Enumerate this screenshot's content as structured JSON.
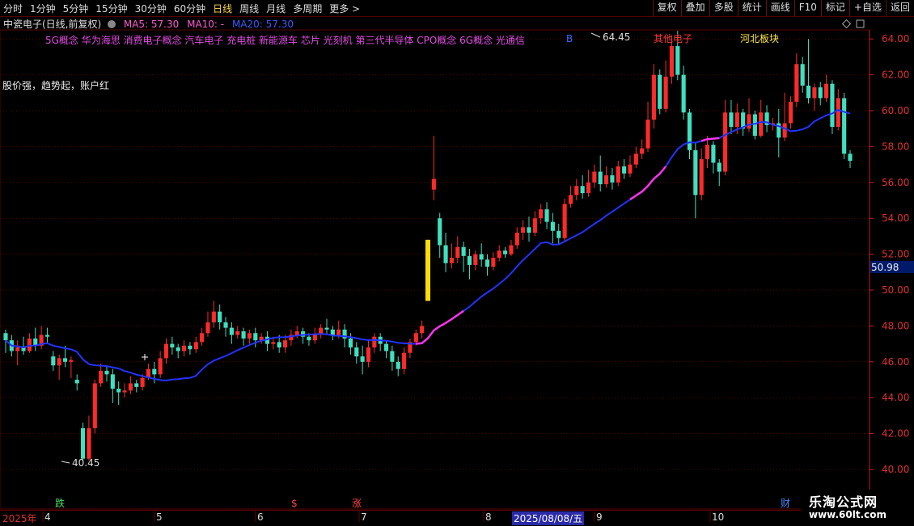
{
  "toolbar": {
    "periods": [
      "分时",
      "1分钟",
      "5分钟",
      "15分钟",
      "30分钟",
      "60分钟",
      "日线",
      "周线",
      "月线",
      "多周期",
      "更多"
    ],
    "active_period": "日线",
    "more_arrow": ">",
    "actions": [
      "复权",
      "叠加",
      "多股",
      "统计",
      "画线",
      "F10",
      "标记",
      "+自选",
      "返回"
    ]
  },
  "info": {
    "stock_title": "中瓷电子(日线,前复权)",
    "ma5": "MA5: 57.30",
    "ma10": "MA10: -",
    "ma20": "MA20: 57.30"
  },
  "concepts": "5G概念 华为海思 消费电子概念 汽车电子 充电桩 新能源车 芯片 光刻机 第三代半导体 CPO概念 6G概念 光通信",
  "slogan": "股价强，趋势起，账户红",
  "markers": {
    "b_label": "B",
    "sector_other": "其他电子",
    "sector_region": "河北板块",
    "high_label": "64.45",
    "low_label": "40.45",
    "current_price": "50.98",
    "fall_badge": "跌",
    "dollar_badge": "$",
    "rise_badge": "涨",
    "fin_badge": "财"
  },
  "dates": {
    "year": "2025年",
    "months": [
      "4",
      "5",
      "6",
      "7",
      "8",
      "9",
      "10"
    ],
    "cursor_date": "2025/08/08/五"
  },
  "watermark": {
    "line1": "乐淘公式网",
    "line2": "www.60lt.com"
  },
  "colors": {
    "up": "#ff2a2a",
    "down": "#3ee0c0",
    "grid": "#5a0000",
    "axis": "#cc2020",
    "ma_blue": "#2233ff",
    "ma_pink": "#ff33ee",
    "volume_bar": "#ffdd00"
  },
  "chart_data": {
    "type": "candlestick",
    "ylim": [
      39,
      65
    ],
    "y_ticks": [
      "40.00",
      "42.00",
      "44.00",
      "46.00",
      "48.00",
      "50.00",
      "52.00",
      "54.00",
      "56.00",
      "58.00",
      "60.00",
      "62.00",
      "64.00"
    ],
    "candles": [
      [
        47.6,
        47.2,
        47.8,
        46.5
      ],
      [
        47.2,
        46.6,
        47.5,
        46.3
      ],
      [
        46.6,
        46.8,
        47.2,
        45.8
      ],
      [
        46.8,
        46.6,
        47.4,
        46.4
      ],
      [
        46.6,
        47.3,
        47.6,
        46.5
      ],
      [
        47.3,
        46.9,
        47.9,
        46.6
      ],
      [
        46.9,
        47.5,
        48.0,
        46.7
      ],
      [
        47.5,
        47.4,
        47.9,
        47.0
      ],
      [
        46.3,
        45.8,
        46.6,
        45.5
      ],
      [
        45.8,
        46.2,
        46.4,
        45.0
      ],
      [
        46.2,
        46.0,
        46.9,
        45.7
      ],
      [
        46.0,
        46.1,
        46.3,
        45.1
      ],
      [
        45.0,
        44.8,
        45.3,
        44.4
      ],
      [
        42.3,
        40.6,
        42.6,
        40.45
      ],
      [
        40.6,
        42.3,
        43.0,
        40.5
      ],
      [
        42.3,
        44.8,
        45.0,
        42.0
      ],
      [
        44.8,
        45.5,
        45.9,
        44.6
      ],
      [
        45.5,
        45.3,
        45.8,
        44.9
      ],
      [
        45.3,
        44.5,
        45.6,
        43.7
      ],
      [
        44.5,
        44.3,
        44.9,
        43.6
      ],
      [
        44.3,
        44.4,
        44.8,
        44.0
      ],
      [
        44.4,
        44.8,
        45.2,
        44.2
      ],
      [
        44.8,
        44.6,
        45.0,
        44.3
      ],
      [
        44.6,
        45.1,
        45.3,
        44.4
      ],
      [
        45.1,
        45.6,
        45.9,
        45.0
      ],
      [
        45.6,
        45.3,
        46.0,
        44.8
      ],
      [
        45.3,
        46.2,
        46.6,
        45.1
      ],
      [
        46.2,
        47.0,
        47.3,
        45.9
      ],
      [
        47.0,
        46.8,
        47.4,
        46.4
      ],
      [
        46.8,
        46.6,
        47.0,
        46.2
      ],
      [
        46.6,
        46.9,
        47.2,
        46.3
      ],
      [
        46.9,
        46.7,
        47.1,
        46.4
      ],
      [
        46.7,
        47.1,
        47.4,
        46.5
      ],
      [
        47.1,
        47.6,
        47.9,
        46.9
      ],
      [
        47.6,
        48.2,
        48.8,
        47.4
      ],
      [
        48.2,
        48.8,
        49.4,
        47.9
      ],
      [
        48.8,
        48.2,
        49.2,
        47.8
      ],
      [
        48.2,
        47.9,
        48.5,
        47.4
      ],
      [
        47.9,
        47.5,
        48.2,
        47.0
      ],
      [
        47.5,
        47.7,
        48.0,
        47.3
      ],
      [
        47.7,
        47.3,
        47.9,
        46.9
      ],
      [
        47.3,
        47.6,
        47.8,
        47.0
      ],
      [
        47.6,
        47.2,
        47.9,
        46.8
      ],
      [
        47.2,
        47.4,
        47.6,
        47.0
      ],
      [
        47.4,
        47.0,
        47.7,
        46.6
      ],
      [
        47.0,
        47.1,
        47.4,
        46.7
      ],
      [
        47.1,
        46.8,
        47.5,
        46.5
      ],
      [
        46.8,
        47.2,
        47.5,
        46.5
      ],
      [
        47.2,
        47.5,
        47.8,
        46.9
      ],
      [
        47.5,
        47.7,
        48.0,
        47.3
      ],
      [
        47.7,
        47.4,
        47.9,
        47.0
      ],
      [
        47.4,
        47.2,
        47.6,
        46.9
      ],
      [
        47.2,
        47.5,
        47.9,
        47.0
      ],
      [
        47.5,
        47.9,
        48.1,
        47.3
      ],
      [
        47.9,
        47.8,
        48.4,
        47.5
      ],
      [
        47.8,
        47.5,
        48.0,
        47.2
      ],
      [
        47.5,
        47.8,
        48.3,
        47.3
      ],
      [
        47.8,
        47.3,
        48.1,
        46.8
      ],
      [
        47.3,
        46.8,
        47.6,
        46.4
      ],
      [
        46.8,
        46.3,
        47.1,
        45.9
      ],
      [
        46.3,
        46.0,
        46.9,
        45.3
      ],
      [
        46.0,
        46.8,
        47.2,
        45.7
      ],
      [
        46.8,
        47.4,
        47.6,
        46.5
      ],
      [
        47.4,
        47.0,
        47.6,
        46.6
      ],
      [
        47.0,
        46.6,
        47.2,
        46.2
      ],
      [
        46.6,
        46.0,
        46.9,
        45.5
      ],
      [
        46.0,
        45.6,
        46.3,
        45.2
      ],
      [
        45.6,
        46.5,
        46.8,
        45.3
      ],
      [
        46.5,
        47.1,
        47.3,
        46.2
      ],
      [
        47.1,
        47.6,
        47.8,
        46.9
      ],
      [
        47.6,
        48.0,
        48.3,
        47.3
      ],
      [
        49.4,
        52.8,
        52.8,
        49.4
      ],
      [
        55.6,
        56.2,
        58.6,
        55.0
      ],
      [
        54.0,
        52.5,
        54.3,
        51.8
      ],
      [
        52.5,
        51.5,
        53.2,
        51.0
      ],
      [
        51.5,
        51.8,
        52.6,
        51.2
      ],
      [
        51.8,
        52.4,
        53.0,
        51.5
      ],
      [
        52.4,
        51.9,
        52.7,
        51.0
      ],
      [
        51.9,
        51.4,
        52.3,
        50.6
      ],
      [
        51.4,
        52.0,
        52.2,
        51.1
      ],
      [
        52.0,
        51.7,
        52.6,
        51.3
      ],
      [
        51.7,
        51.3,
        52.0,
        50.8
      ],
      [
        51.3,
        51.8,
        52.1,
        51.1
      ],
      [
        51.8,
        52.2,
        52.5,
        51.6
      ],
      [
        52.2,
        52.0,
        52.4,
        51.8
      ],
      [
        52.0,
        52.5,
        52.8,
        51.9
      ],
      [
        52.5,
        53.2,
        53.5,
        52.3
      ],
      [
        53.2,
        53.5,
        53.9,
        52.8
      ],
      [
        53.5,
        53.2,
        54.1,
        52.7
      ],
      [
        53.2,
        54.0,
        54.4,
        53.0
      ],
      [
        54.0,
        54.5,
        54.8,
        53.7
      ],
      [
        54.5,
        53.8,
        54.9,
        53.4
      ],
      [
        53.8,
        53.3,
        54.3,
        52.6
      ],
      [
        53.3,
        52.9,
        53.7,
        52.5
      ],
      [
        52.9,
        54.8,
        55.1,
        52.7
      ],
      [
        54.8,
        55.3,
        55.8,
        54.6
      ],
      [
        55.3,
        55.8,
        56.2,
        55.0
      ],
      [
        55.8,
        55.4,
        56.4,
        55.1
      ],
      [
        55.4,
        56.0,
        56.7,
        55.2
      ],
      [
        56.0,
        56.6,
        57.0,
        55.7
      ],
      [
        56.6,
        55.9,
        57.5,
        55.5
      ],
      [
        55.9,
        56.4,
        56.9,
        55.7
      ],
      [
        56.4,
        56.0,
        56.8,
        55.6
      ],
      [
        56.0,
        56.9,
        57.2,
        55.8
      ],
      [
        56.9,
        56.5,
        57.3,
        56.2
      ],
      [
        56.5,
        57.0,
        57.5,
        56.3
      ],
      [
        57.0,
        57.6,
        58.0,
        56.8
      ],
      [
        57.6,
        57.9,
        58.4,
        57.3
      ],
      [
        57.9,
        59.5,
        60.5,
        57.7
      ],
      [
        59.5,
        62.0,
        62.6,
        59.0
      ],
      [
        62.0,
        60.1,
        62.3,
        59.8
      ],
      [
        60.1,
        61.9,
        62.8,
        59.9
      ],
      [
        61.9,
        63.6,
        64.0,
        61.5
      ],
      [
        63.6,
        62.0,
        64.45,
        61.7
      ],
      [
        62.0,
        59.9,
        62.5,
        59.5
      ],
      [
        59.9,
        57.8,
        60.1,
        57.3
      ],
      [
        57.8,
        55.3,
        58.2,
        54.0
      ],
      [
        55.3,
        57.3,
        57.9,
        55.0
      ],
      [
        57.3,
        58.1,
        58.6,
        56.8
      ],
      [
        58.1,
        57.1,
        58.3,
        56.5
      ],
      [
        57.1,
        56.6,
        57.3,
        55.8
      ],
      [
        56.6,
        59.9,
        60.6,
        56.4
      ],
      [
        59.9,
        59.1,
        60.6,
        58.7
      ],
      [
        59.1,
        59.9,
        60.4,
        58.7
      ],
      [
        59.9,
        59.0,
        60.1,
        58.6
      ],
      [
        59.0,
        59.8,
        60.7,
        58.8
      ],
      [
        59.8,
        58.6,
        60.0,
        58.4
      ],
      [
        58.6,
        59.9,
        60.6,
        58.5
      ],
      [
        59.9,
        59.2,
        60.3,
        58.8
      ],
      [
        59.2,
        59.3,
        59.6,
        58.9
      ],
      [
        59.3,
        58.5,
        60.1,
        57.4
      ],
      [
        58.5,
        59.3,
        61.0,
        58.3
      ],
      [
        59.3,
        60.5,
        60.8,
        59.0
      ],
      [
        60.5,
        62.6,
        63.2,
        60.2
      ],
      [
        62.6,
        61.4,
        63.0,
        61.0
      ],
      [
        61.4,
        60.7,
        64.0,
        60.4
      ],
      [
        60.7,
        61.3,
        61.5,
        60.0
      ],
      [
        61.3,
        60.7,
        61.6,
        60.3
      ],
      [
        60.7,
        61.5,
        62.0,
        60.5
      ],
      [
        61.5,
        59.1,
        61.7,
        58.7
      ],
      [
        59.1,
        60.7,
        61.2,
        58.9
      ],
      [
        60.7,
        57.6,
        61.0,
        57.3
      ],
      [
        57.6,
        57.2,
        57.8,
        56.8
      ]
    ]
  }
}
